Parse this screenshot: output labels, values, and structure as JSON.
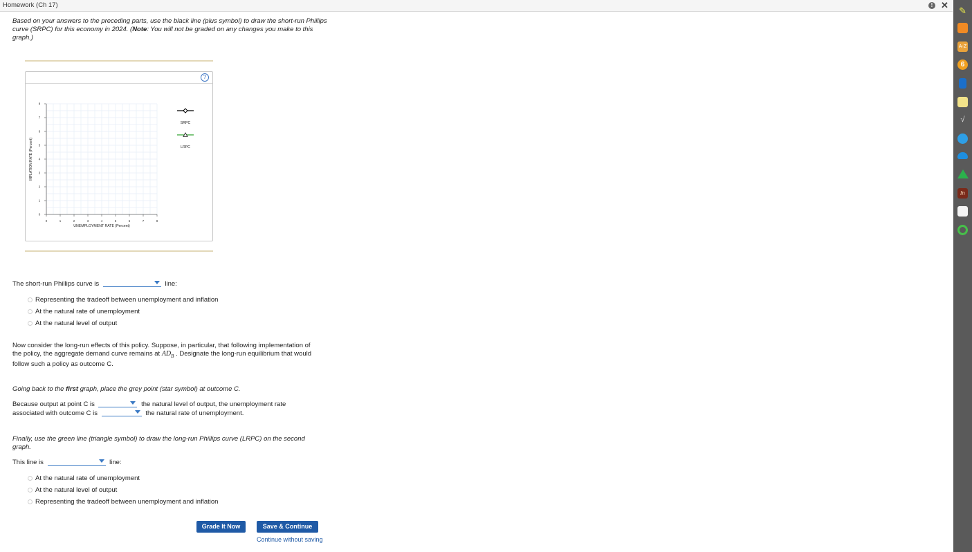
{
  "window": {
    "title": "Homework (Ch 17)"
  },
  "intro": {
    "text": "Based on your answers to the preceding parts, use the black line (plus symbol) to draw the short-run Phillips curve (SRPC) for this economy in 2024. (",
    "note_label": "Note",
    "note_text": ": You will not be graded on any changes you make to this graph.)"
  },
  "graph": {
    "help": "?",
    "ylabel": "INFLATION RATE (Percent)",
    "xlabel": "UNEMPLOYMENT RATE (Percent)",
    "xticks": [
      "0",
      "1",
      "2",
      "3",
      "4",
      "5",
      "6",
      "7",
      "8"
    ],
    "yticks": [
      "0",
      "1",
      "2",
      "3",
      "4",
      "5",
      "6",
      "7",
      "8"
    ],
    "legend": [
      {
        "label": "SRPC",
        "color": "#000000",
        "symbol": "plus"
      },
      {
        "label": "LRPC",
        "color": "#33a532",
        "symbol": "triangle"
      }
    ]
  },
  "q1": {
    "prefix": "The short-run Phillips curve is",
    "suffix": "line:",
    "options": [
      "Representing the tradeoff between unemployment and inflation",
      "At the natural rate of unemployment",
      "At the natural level of output"
    ]
  },
  "para2": {
    "text1": "Now consider the long-run effects of this policy. Suppose, in particular, that following implementation of the policy, the aggregate demand curve remains at",
    "math": "AD",
    "math_sub": "B",
    "text2": ". Designate the long-run equilibrium that would follow such a policy as outcome C."
  },
  "para3": {
    "pre": "Going back to the",
    "bold": "first",
    "post": "graph, place the grey point (star symbol) at outcome C."
  },
  "q2": {
    "a": "Because output at point C is",
    "b": "the natural level of output, the unemployment rate",
    "c": "associated with outcome C is",
    "d": "the natural rate of unemployment."
  },
  "para4": {
    "text": "Finally, use the green line (triangle symbol) to draw the long-run Phillips curve (LRPC) on the second graph."
  },
  "q3": {
    "prefix": "This line is",
    "suffix": "line:",
    "options": [
      "At the natural rate of unemployment",
      "At the natural level of output",
      "Representing the tradeoff between unemployment and inflation"
    ]
  },
  "buttons": {
    "grade": "Grade It Now",
    "save": "Save & Continue",
    "continue": "Continue without saving"
  },
  "colors": {
    "accent": "#1f5aa6",
    "dropdown": "#3a79c4",
    "lrpc": "#33a532"
  }
}
